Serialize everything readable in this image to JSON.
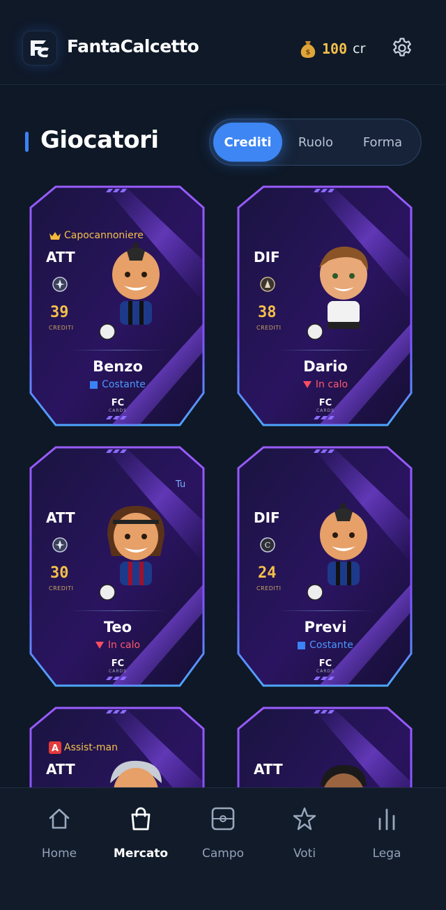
{
  "app": {
    "title": "FantaCalcetto",
    "logo_icon": "fc-logo-icon"
  },
  "header": {
    "credits_value": "100",
    "credits_unit": "cr",
    "credits_icon": "money-bag-icon",
    "settings_icon": "gear-icon"
  },
  "section": {
    "title": "Giocatori"
  },
  "sort_tabs": [
    {
      "label": "Crediti",
      "active": true
    },
    {
      "label": "Ruolo",
      "active": false
    },
    {
      "label": "Forma",
      "active": false
    }
  ],
  "cards": [
    {
      "badge": "Capocannoniere",
      "badge_icon": "crown-icon",
      "role": "ATT",
      "price": "39",
      "price_label": "CREDITI",
      "name": "Benzo",
      "trend": "Costante",
      "trend_type": "steady",
      "brand": "FC",
      "brand_sub": "CARDS"
    },
    {
      "badge": "",
      "role": "DIF",
      "price": "38",
      "price_label": "CREDITI",
      "name": "Dario",
      "trend": "In calo",
      "trend_type": "down",
      "brand": "FC",
      "brand_sub": "CARDS"
    },
    {
      "badge": "",
      "tag": "Tu",
      "role": "ATT",
      "price": "30",
      "price_label": "CREDITI",
      "name": "Teo",
      "trend": "In calo",
      "trend_type": "down",
      "brand": "FC",
      "brand_sub": "CARDS"
    },
    {
      "badge": "",
      "role": "DIF",
      "price": "24",
      "price_label": "CREDITI",
      "name": "Previ",
      "trend": "Costante",
      "trend_type": "steady",
      "brand": "FC",
      "brand_sub": "CARDS"
    },
    {
      "badge": "Assist-man",
      "badge_icon": "letter-a-icon",
      "role": "ATT"
    },
    {
      "badge": "",
      "role": "ATT"
    }
  ],
  "nav": [
    {
      "label": "Home",
      "icon": "home-icon",
      "active": false
    },
    {
      "label": "Mercato",
      "icon": "shopping-bag-icon",
      "active": true
    },
    {
      "label": "Campo",
      "icon": "pitch-icon",
      "active": false
    },
    {
      "label": "Voti",
      "icon": "star-icon",
      "active": false
    },
    {
      "label": "Lega",
      "icon": "bar-chart-icon",
      "active": false
    }
  ],
  "colors": {
    "accent": "#3d86f4",
    "gold": "#f4c04a",
    "down": "#ff5a6e",
    "card_purple": "#8a4dff"
  }
}
